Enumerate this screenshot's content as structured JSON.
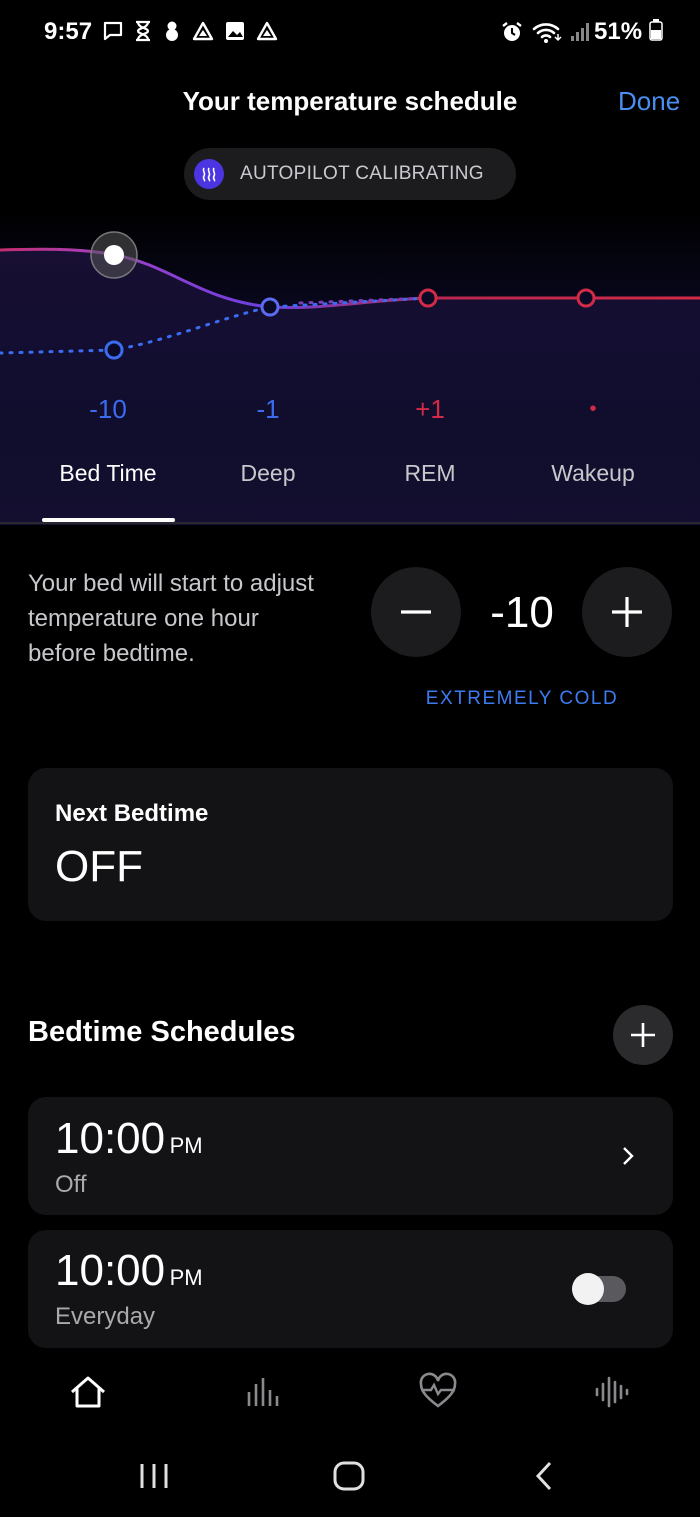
{
  "status_bar": {
    "time": "9:57",
    "battery": "51%",
    "left_icons": [
      "message-icon",
      "hourglass-icon",
      "snowman-icon",
      "triangle-icon",
      "image-icon",
      "triangle-icon"
    ],
    "right_icons": [
      "alarm-icon",
      "wifi-icon",
      "signal-icon",
      "battery-icon"
    ]
  },
  "header": {
    "title": "Your temperature schedule",
    "done_label": "Done"
  },
  "autopilot": {
    "label": "AUTOPILOT CALIBRATING",
    "icon": "heat-waves-icon"
  },
  "stages": [
    {
      "label": "Bed Time",
      "value": "-10",
      "color": "#3b6cf0",
      "active": true
    },
    {
      "label": "Deep",
      "value": "-1",
      "color": "#3b6cf0",
      "active": false
    },
    {
      "label": "REM",
      "value": "+1",
      "color": "#d22a47",
      "active": false
    },
    {
      "label": "Wakeup",
      "value": "•",
      "color": "#d22a47",
      "active": false
    }
  ],
  "adjust": {
    "description": "Your bed will start to adjust temperature one hour before bedtime.",
    "value": "-10",
    "level_label": "EXTREMELY COLD",
    "minus_icon": "minus-icon",
    "plus_icon": "plus-icon"
  },
  "next_bedtime": {
    "label": "Next Bedtime",
    "value": "OFF"
  },
  "schedules": {
    "title": "Bedtime Schedules",
    "add_icon": "plus-icon",
    "items": [
      {
        "time": "10:00",
        "ampm": "PM",
        "sub": "Off",
        "control": "chevron"
      },
      {
        "time": "10:00",
        "ampm": "PM",
        "sub": "Everyday",
        "control": "toggle",
        "enabled": false
      }
    ]
  },
  "bottom_nav": [
    "home-icon",
    "bar-chart-icon",
    "heart-health-icon",
    "audio-waves-icon"
  ],
  "system_nav": [
    "recents-icon",
    "home-button-icon",
    "back-icon"
  ],
  "colors": {
    "accent_blue": "#3b6cf0",
    "accent_red": "#d22a47",
    "done_blue": "#4a8ef0",
    "card_bg": "#131315"
  }
}
